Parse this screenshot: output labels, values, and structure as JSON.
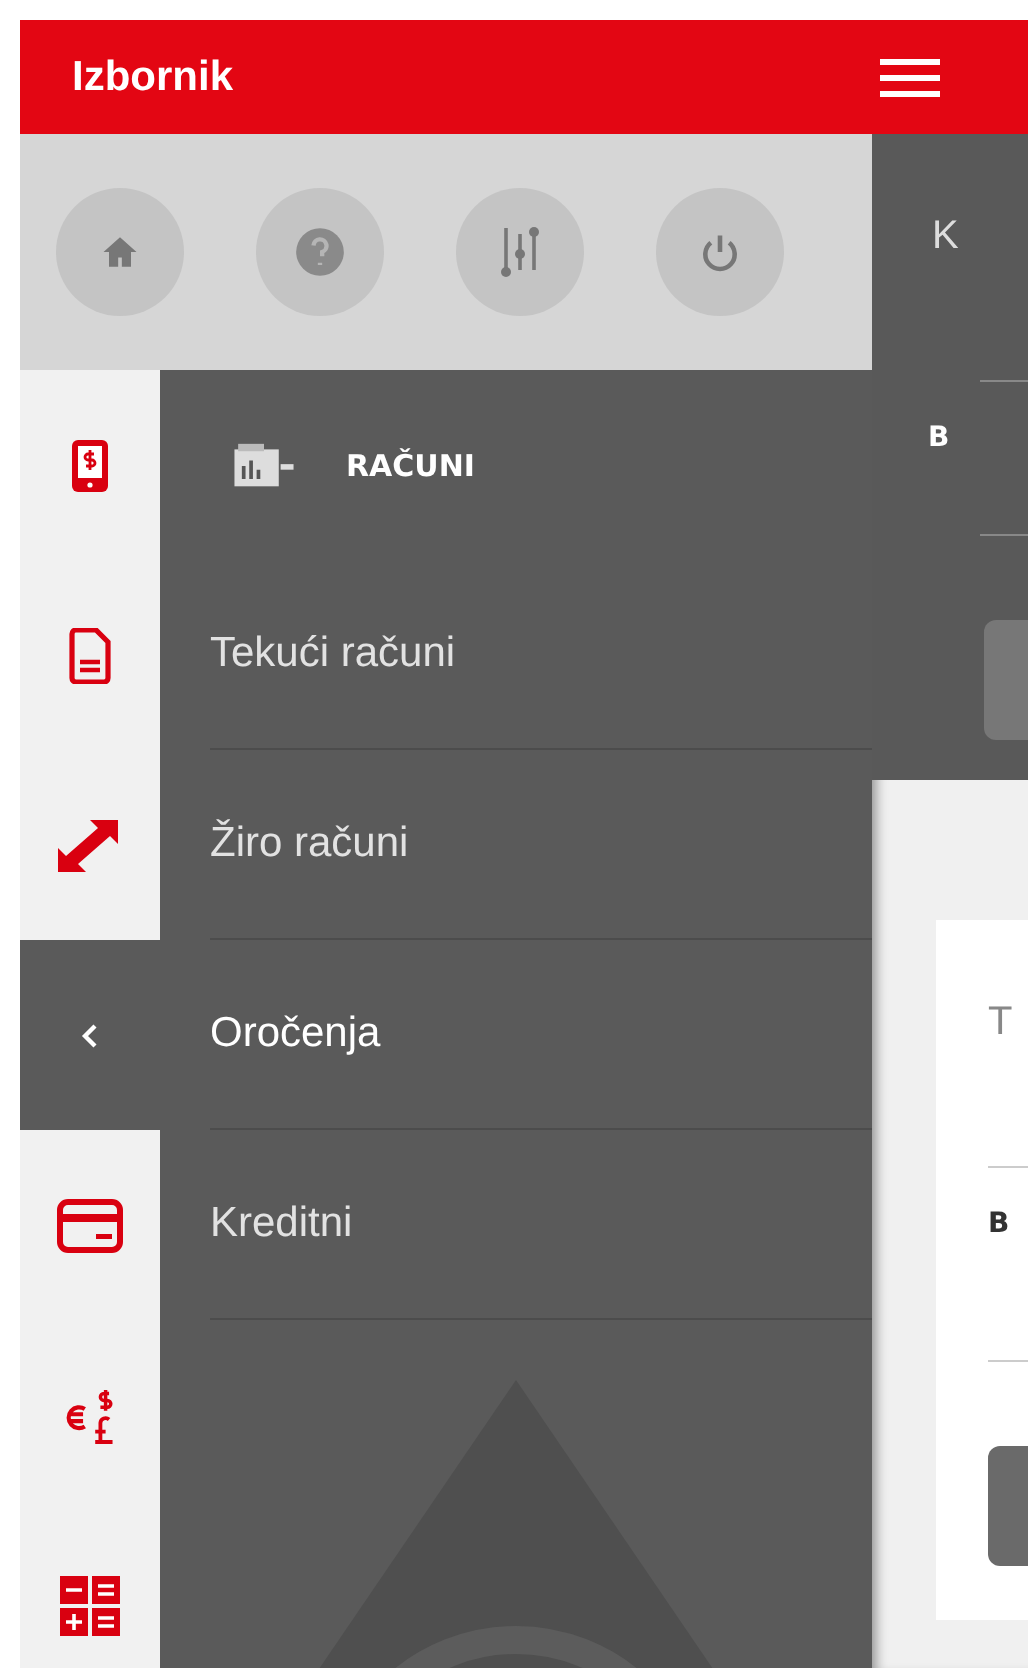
{
  "drawer": {
    "title": "Izbornik",
    "quick_actions": [
      {
        "kind": "home"
      },
      {
        "kind": "help"
      },
      {
        "kind": "settings"
      },
      {
        "kind": "power"
      }
    ],
    "rail": [
      {
        "kind": "phone"
      },
      {
        "kind": "document"
      },
      {
        "kind": "transfer"
      },
      {
        "kind": "chevron"
      },
      {
        "kind": "card"
      },
      {
        "kind": "currency"
      },
      {
        "kind": "calculator"
      }
    ],
    "section": {
      "title": "RAČUNI"
    },
    "items": [
      {
        "label": "Tekući računi",
        "selected": false
      },
      {
        "label": "Žiro računi",
        "selected": false
      },
      {
        "label": "Oročenja",
        "selected": true
      },
      {
        "label": "Kreditni",
        "selected": false
      }
    ]
  },
  "content": {
    "panels": [
      {
        "kind": "dark",
        "title": "K",
        "label": "B"
      },
      {
        "kind": "card",
        "title": "T",
        "label": "B"
      }
    ]
  }
}
